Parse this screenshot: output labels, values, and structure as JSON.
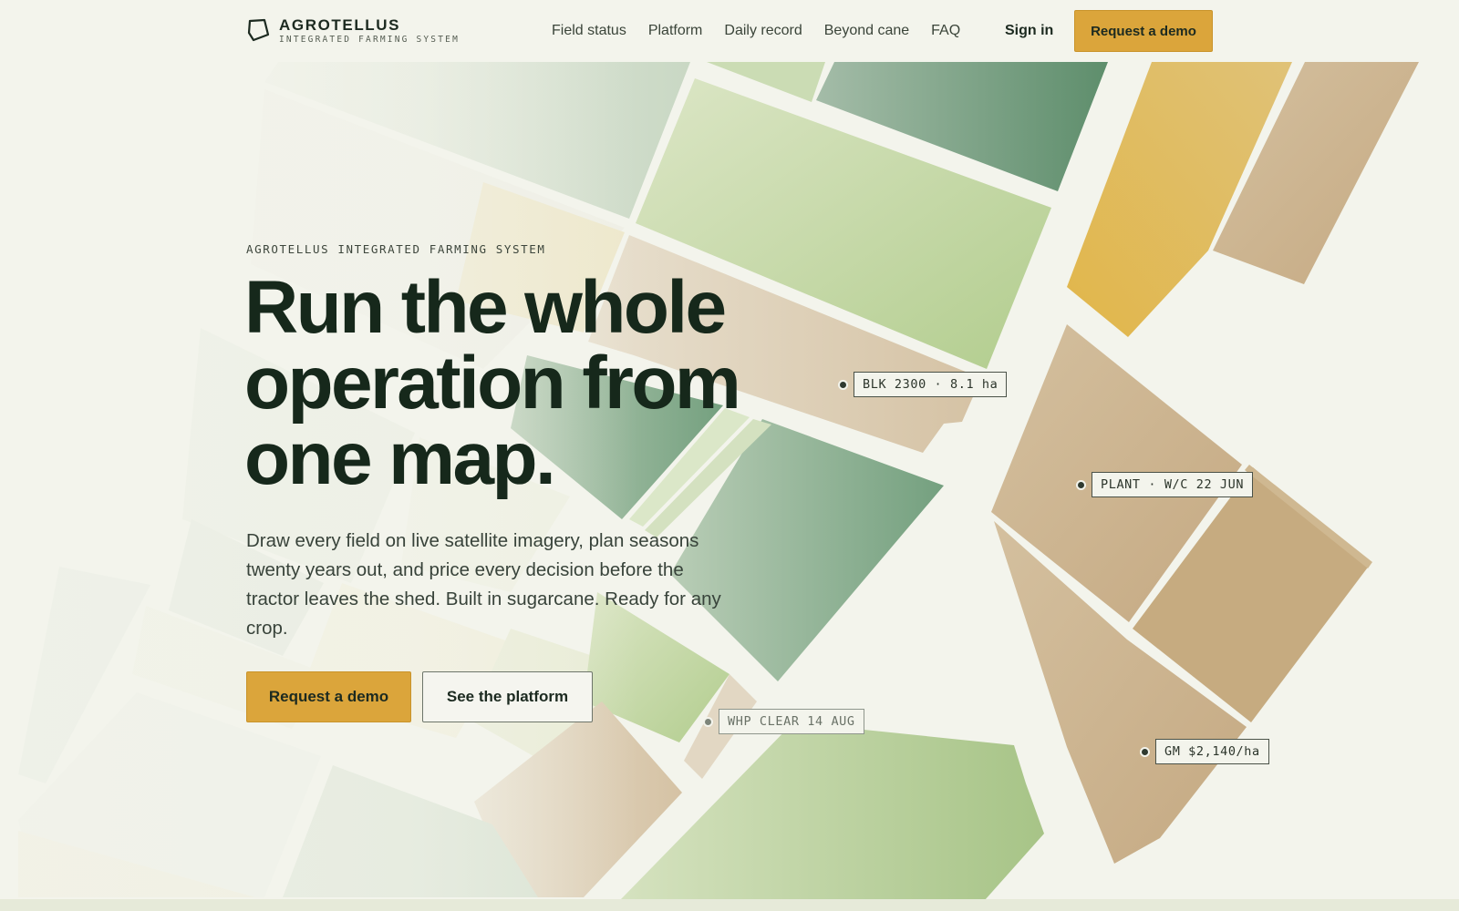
{
  "header": {
    "brand_name": "AGROTELLUS",
    "brand_tagline": "INTEGRATED FARMING SYSTEM",
    "nav": [
      {
        "label": "Field status"
      },
      {
        "label": "Platform"
      },
      {
        "label": "Daily record"
      },
      {
        "label": "Beyond cane"
      },
      {
        "label": "FAQ"
      }
    ],
    "sign_in": "Sign in",
    "cta": "Request a demo"
  },
  "hero": {
    "eyebrow": "AGROTELLUS INTEGRATED FARMING SYSTEM",
    "headline": "Run the whole operation from one map.",
    "lede": "Draw every field on live satellite imagery, plan seasons twenty years out, and price every decision before the tractor leaves the shed. Built in sugarcane. Ready for any crop.",
    "primary_cta": "Request a demo",
    "secondary_cta": "See the platform"
  },
  "map_tags": [
    {
      "text": "BLK 2300 · 8.1 ha"
    },
    {
      "text": "PLANT · W/C 22 JUN"
    },
    {
      "text": "WHP CLEAR 14 AUG"
    },
    {
      "text": "GM $2,140/ha"
    }
  ],
  "colors": {
    "background": "#f3f4ec",
    "accent": "#dba53b",
    "ink": "#16281b",
    "field_green": "#6e9a78",
    "field_tan": "#c9ae86",
    "field_yellow": "#e3bc55"
  }
}
